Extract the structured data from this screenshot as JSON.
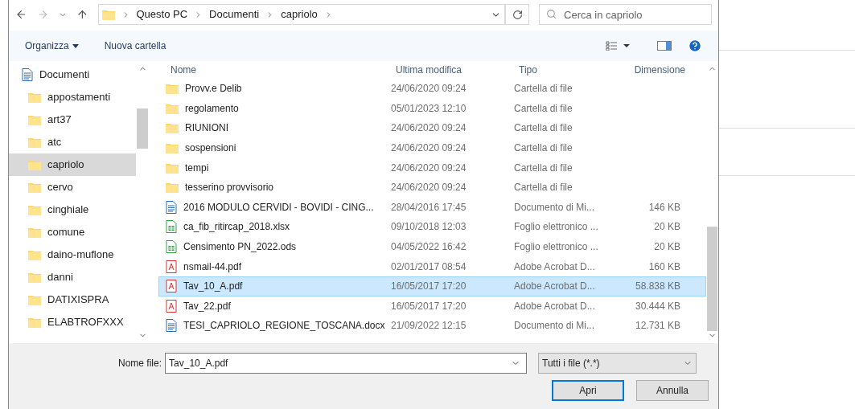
{
  "address_bar": {
    "path": [
      "Questo PC",
      "Documenti",
      "capriolo"
    ]
  },
  "search": {
    "placeholder": "Cerca in capriolo"
  },
  "toolbar": {
    "organize": "Organizza",
    "new_folder": "Nuova cartella"
  },
  "sidebar": {
    "items": [
      {
        "label": "Documenti",
        "kind": "doc",
        "selected": false,
        "children": [
          {
            "label": "appostamenti",
            "kind": "folder",
            "selected": false
          },
          {
            "label": "art37",
            "kind": "folder",
            "selected": false
          },
          {
            "label": "atc",
            "kind": "folder",
            "selected": false
          },
          {
            "label": "capriolo",
            "kind": "folder",
            "selected": true
          },
          {
            "label": "cervo",
            "kind": "folder",
            "selected": false
          },
          {
            "label": "cinghiale",
            "kind": "folder",
            "selected": false
          },
          {
            "label": "comune",
            "kind": "folder",
            "selected": false
          },
          {
            "label": "daino-muflone",
            "kind": "folder",
            "selected": false
          },
          {
            "label": "danni",
            "kind": "folder",
            "selected": false
          },
          {
            "label": "DATIXISPRA",
            "kind": "folder",
            "selected": false
          },
          {
            "label": "ELABTROFXXX",
            "kind": "folder",
            "selected": false
          }
        ]
      }
    ]
  },
  "table": {
    "columns": [
      "Nome",
      "Ultima modifica",
      "Tipo",
      "Dimensione"
    ],
    "rows": [
      {
        "kind": "folder",
        "name": "Provv.e Delib",
        "modified": "24/06/2020 09:24",
        "type": "Cartella di file",
        "size": "",
        "selected": false
      },
      {
        "kind": "folder",
        "name": "regolamento",
        "modified": "05/01/2023 12:10",
        "type": "Cartella di file",
        "size": "",
        "selected": false
      },
      {
        "kind": "folder",
        "name": "RIUNIONI",
        "modified": "24/06/2020 09:24",
        "type": "Cartella di file",
        "size": "",
        "selected": false
      },
      {
        "kind": "folder",
        "name": "sospensioni",
        "modified": "24/06/2020 09:24",
        "type": "Cartella di file",
        "size": "",
        "selected": false
      },
      {
        "kind": "folder",
        "name": "tempi",
        "modified": "24/06/2020 09:24",
        "type": "Cartella di file",
        "size": "",
        "selected": false
      },
      {
        "kind": "folder",
        "name": "tesserino provvisorio",
        "modified": "24/06/2020 09:24",
        "type": "Cartella di file",
        "size": "",
        "selected": false
      },
      {
        "kind": "doc",
        "name": "2016 MODULO CERVIDI - BOVIDI - CING...",
        "modified": "28/04/2016 17:45",
        "type": "Documento di Mi...",
        "size": "146 KB",
        "selected": false
      },
      {
        "kind": "sheet",
        "name": "ca_fib_ritircap_2018.xlsx",
        "modified": "09/10/2018 12:03",
        "type": "Foglio elettronico ...",
        "size": "20 KB",
        "selected": false
      },
      {
        "kind": "sheet",
        "name": "Censimento PN_2022.ods",
        "modified": "04/05/2022 16:42",
        "type": "Foglio elettronico ...",
        "size": "20 KB",
        "selected": false
      },
      {
        "kind": "pdf",
        "name": "nsmail-44.pdf",
        "modified": "02/01/2017 08:54",
        "type": "Adobe Acrobat D...",
        "size": "160 KB",
        "selected": false
      },
      {
        "kind": "pdf",
        "name": "Tav_10_A.pdf",
        "modified": "16/05/2017 17:20",
        "type": "Adobe Acrobat D...",
        "size": "58.838 KB",
        "selected": true
      },
      {
        "kind": "pdf",
        "name": "Tav_22.pdf",
        "modified": "16/05/2017 17:20",
        "type": "Adobe Acrobat D...",
        "size": "30.444 KB",
        "selected": false
      },
      {
        "kind": "doc",
        "name": "TESI_CAPRIOLO_REGIONE_TOSCANA.docx",
        "modified": "21/09/2022 12:15",
        "type": "Documento di Mi...",
        "size": "12.731 KB",
        "selected": false
      }
    ]
  },
  "footer": {
    "filename_label": "Nome file:",
    "filename": "Tav_10_A.pdf",
    "filter": "Tutti i file (*.*)",
    "open": "Apri",
    "cancel": "Annulla"
  }
}
